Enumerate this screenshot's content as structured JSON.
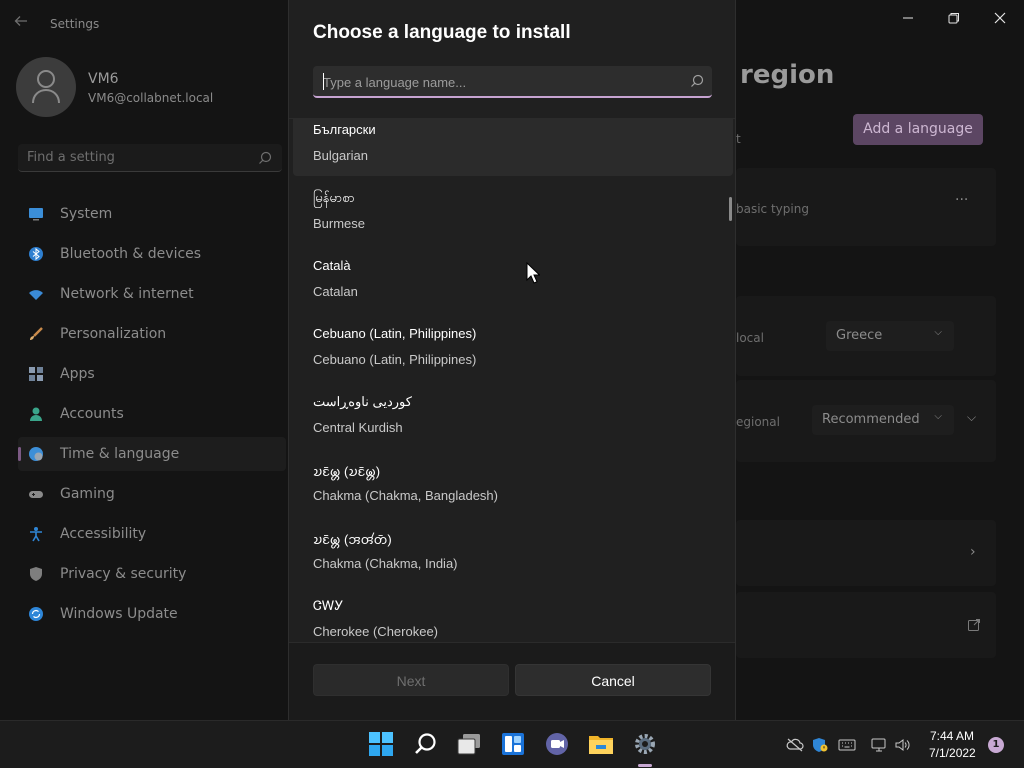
{
  "settings": {
    "app_title": "Settings",
    "profile": {
      "name": "VM6",
      "email": "VM6@collabnet.local"
    },
    "find_placeholder": "Find a setting",
    "nav": [
      {
        "label": "System",
        "icon": "monitor-icon",
        "color": "#3b8ed8"
      },
      {
        "label": "Bluetooth & devices",
        "icon": "bluetooth-icon",
        "color": "#2e7fd0"
      },
      {
        "label": "Network & internet",
        "icon": "wifi-icon",
        "color": "#3a8ad6"
      },
      {
        "label": "Personalization",
        "icon": "brush-icon",
        "color": "#c98a4a"
      },
      {
        "label": "Apps",
        "icon": "apps-icon",
        "color": "#8a9bb0"
      },
      {
        "label": "Accounts",
        "icon": "person-icon",
        "color": "#3aa58a"
      },
      {
        "label": "Time & language",
        "icon": "globe-clock-icon",
        "color": "#3d8fd8",
        "selected": true
      },
      {
        "label": "Gaming",
        "icon": "gamepad-icon",
        "color": "#8a8a8a"
      },
      {
        "label": "Accessibility",
        "icon": "accessibility-icon",
        "color": "#2f86d6"
      },
      {
        "label": "Privacy & security",
        "icon": "shield-icon",
        "color": "#7e7e7e"
      },
      {
        "label": "Windows Update",
        "icon": "update-icon",
        "color": "#2e86d8"
      }
    ],
    "right_title": "region",
    "add_language_label": "Add a language",
    "partial_labels": {
      "t": "t",
      "basic_typing": "basic typing",
      "local": "local",
      "regional": "egional"
    },
    "country_value": "Greece",
    "regional_format_value": "Recommended"
  },
  "dialog": {
    "title": "Choose a language to install",
    "search_placeholder": "Type a language name...",
    "languages": [
      {
        "native": "Български",
        "english": "Bulgarian"
      },
      {
        "native": "မြန်မာစာ",
        "english": "Burmese"
      },
      {
        "native": "Català",
        "english": "Catalan"
      },
      {
        "native": "Cebuano (Latin, Philippines)",
        "english": "Cebuano (Latin, Philippines)"
      },
      {
        "native": "کوردیی ناوەڕاست",
        "english": "Central Kurdish"
      },
      {
        "native": "𑄌𑄋𑄴𑄟𑄳𑄦 (𑄌𑄋𑄴𑄟𑄳𑄦)",
        "english": "Chakma (Chakma, Bangladesh)"
      },
      {
        "native": "𑄌𑄋𑄴𑄟𑄳𑄦 (𑄞𑄢𑄧𑄖𑄴)",
        "english": "Chakma (Chakma, India)"
      },
      {
        "native": "ᏣᎳᎩ",
        "english": "Cherokee (Cherokee)"
      }
    ],
    "next_label": "Next",
    "cancel_label": "Cancel"
  },
  "taskbar": {
    "apps": [
      "windows-start-icon",
      "search-icon",
      "task-view-icon",
      "widgets-icon",
      "teams-chat-icon",
      "file-explorer-icon",
      "settings-gear-icon"
    ],
    "time": "7:44 AM",
    "date": "7/1/2022",
    "notification_count": "1"
  }
}
